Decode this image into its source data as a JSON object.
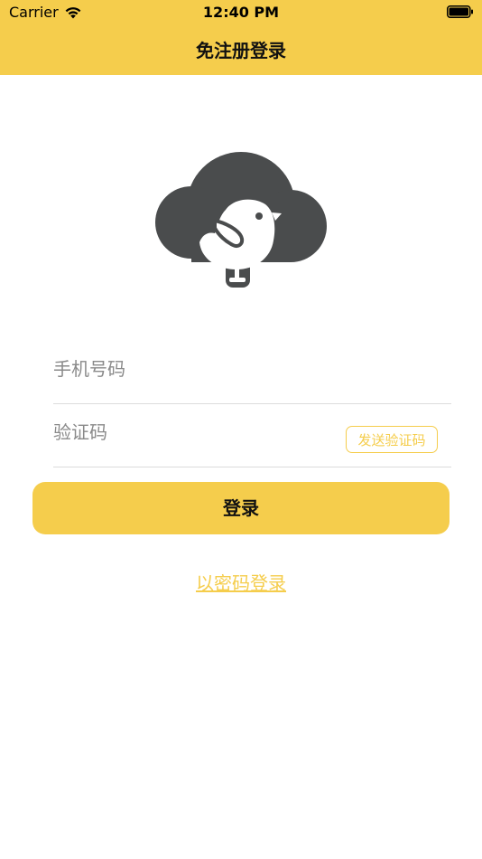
{
  "status_bar": {
    "carrier": "Carrier",
    "time": "12:40 PM"
  },
  "nav": {
    "title": "免注册登录"
  },
  "form": {
    "phone_placeholder": "手机号码",
    "code_placeholder": "验证码",
    "send_code_label": "发送验证码",
    "login_label": "登录",
    "password_login_link": "以密码登录"
  },
  "colors": {
    "accent": "#f5cd4c",
    "logo": "#4a4c4d"
  },
  "icons": {
    "logo": "cloud-bird-logo",
    "wifi": "wifi-icon",
    "battery": "battery-icon"
  }
}
